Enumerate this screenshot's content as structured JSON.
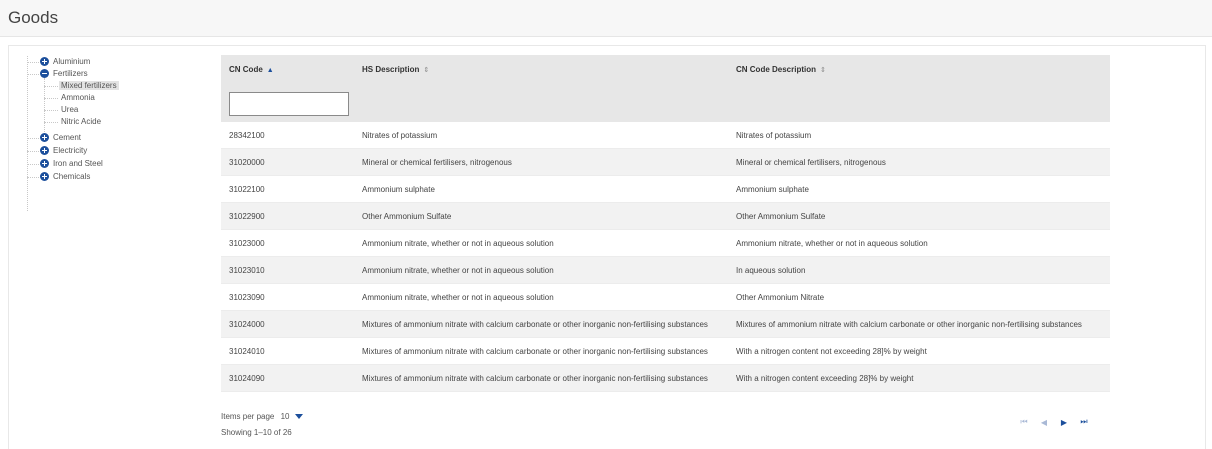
{
  "page": {
    "title": "Goods"
  },
  "tree": {
    "nodes": [
      {
        "label": "Aluminium",
        "expanded": false
      },
      {
        "label": "Fertilizers",
        "expanded": true,
        "children": [
          "Mixed fertilizers",
          "Ammonia",
          "Urea",
          "Nitric Acide"
        ],
        "selected_child": "Mixed fertilizers"
      },
      {
        "label": "Cement",
        "expanded": false
      },
      {
        "label": "Electricity",
        "expanded": false
      },
      {
        "label": "Iron and Steel",
        "expanded": false
      },
      {
        "label": "Chemicals",
        "expanded": false
      }
    ]
  },
  "table": {
    "columns": [
      {
        "label": "CN Code",
        "sort_glyph": "▲",
        "sorted": true
      },
      {
        "label": "HS Description",
        "sort_glyph": "⇕",
        "sorted": false
      },
      {
        "label": "CN Code Description",
        "sort_glyph": "⇕",
        "sorted": false
      }
    ],
    "filter_value": "",
    "rows": [
      [
        "28342100",
        "Nitrates of potassium",
        "Nitrates of potassium"
      ],
      [
        "31020000",
        "Mineral or chemical fertilisers, nitrogenous",
        "Mineral or chemical fertilisers, nitrogenous"
      ],
      [
        "31022100",
        "Ammonium sulphate",
        "Ammonium sulphate"
      ],
      [
        "31022900",
        "Other Ammonium Sulfate",
        "Other Ammonium Sulfate"
      ],
      [
        "31023000",
        "Ammonium nitrate, whether or not in aqueous solution",
        "Ammonium nitrate, whether or not in aqueous solution"
      ],
      [
        "31023010",
        "Ammonium nitrate, whether or not in aqueous solution",
        "In aqueous solution"
      ],
      [
        "31023090",
        "Ammonium nitrate, whether or not in aqueous solution",
        "Other Ammonium Nitrate"
      ],
      [
        "31024000",
        "Mixtures of ammonium nitrate with calcium carbonate or other inorganic non-fertilising substances",
        "Mixtures of ammonium nitrate with calcium carbonate or other inorganic non-fertilising substances"
      ],
      [
        "31024010",
        "Mixtures of ammonium nitrate with calcium carbonate or other inorganic non-fertilising substances",
        "With a nitrogen content not exceeding 28]% by weight"
      ],
      [
        "31024090",
        "Mixtures of ammonium nitrate with calcium carbonate or other inorganic non-fertilising substances",
        "With a nitrogen content exceeding 28]% by weight"
      ]
    ]
  },
  "footer": {
    "items_per_page_label": "Items per page",
    "items_per_page_value": "10",
    "showing": "Showing 1–10 of 26"
  },
  "pager": {
    "first_icon": "first-page-icon",
    "prev_icon": "previous-page-icon",
    "next_icon": "next-page-icon",
    "last_icon": "last-page-icon",
    "first_glyph": "⏮",
    "prev_glyph": "◀",
    "next_glyph": "▶",
    "last_glyph": "⏭"
  },
  "colors": {
    "accent": "#1c4f9c",
    "header_bg": "#e7e7e7",
    "row_alt": "#f2f2f2"
  }
}
